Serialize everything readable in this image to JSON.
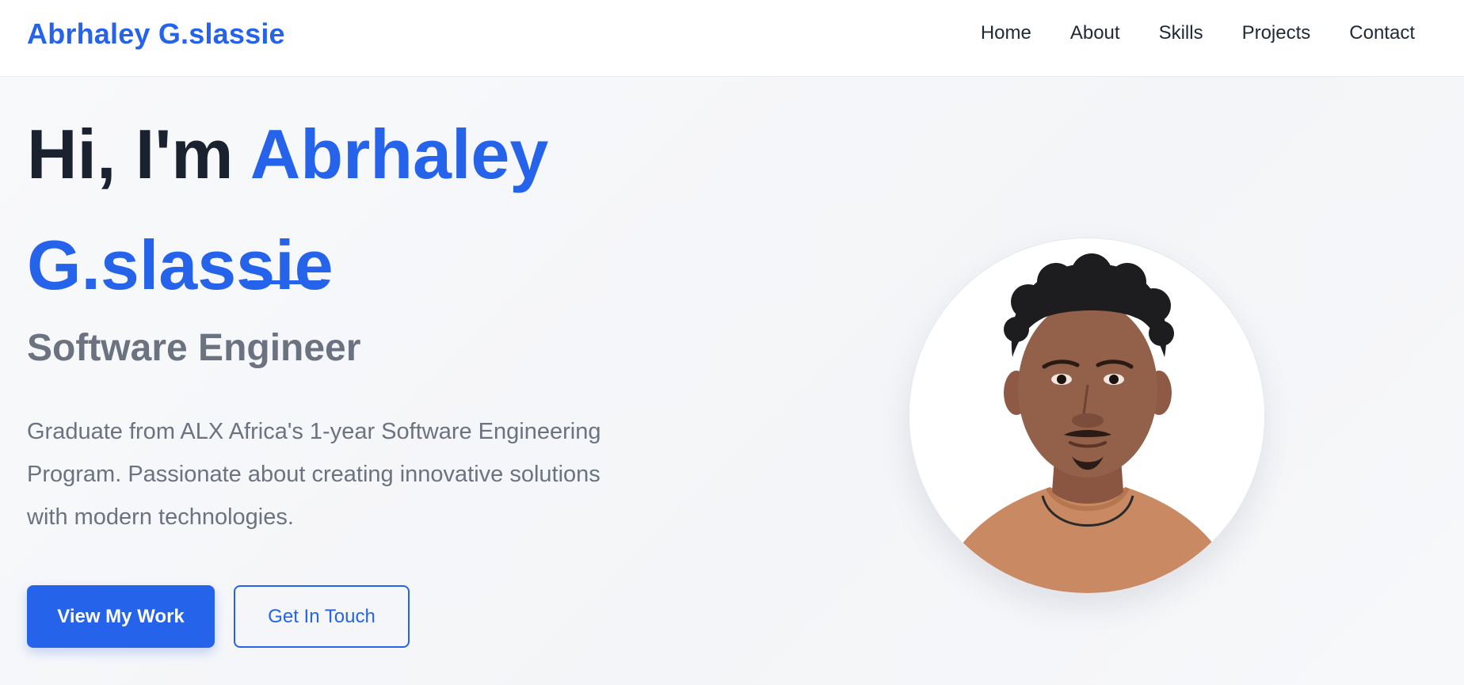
{
  "nav": {
    "brand": "Abrhaley G.slassie",
    "links": [
      "Home",
      "About",
      "Skills",
      "Projects",
      "Contact"
    ]
  },
  "hero": {
    "greeting": "Hi, I'm ",
    "name_first": "Abrhaley",
    "name_last": "G.slassie",
    "subtitle": "Software Engineer",
    "intro": "Graduate from ALX Africa's 1-year Software Engineering Program. Passionate about creating innovative solutions with modern technologies.",
    "primary_button": "View My Work",
    "secondary_button": "Get In Touch"
  },
  "colors": {
    "accent": "#2563eb",
    "heading": "#1a2230",
    "muted": "#6b7280"
  },
  "icons": {
    "avatar": "profile-photo"
  }
}
